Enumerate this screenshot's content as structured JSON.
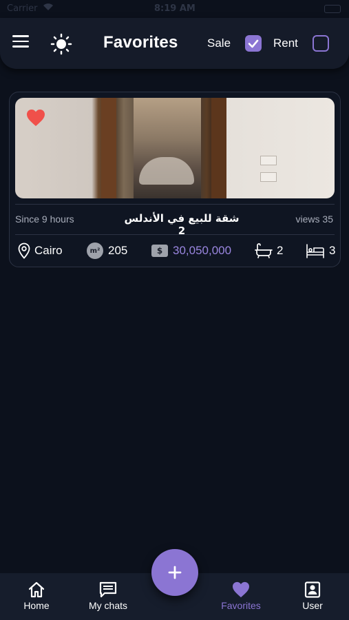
{
  "status_bar": {
    "carrier": "Carrier",
    "time": "8:19 AM"
  },
  "header": {
    "title": "Favorites",
    "filters": [
      {
        "label": "Sale",
        "checked": true
      },
      {
        "label": "Rent",
        "checked": false
      }
    ]
  },
  "listings": [
    {
      "favorited": true,
      "since": "Since 9 hours",
      "title": "شقة للبيع في الأندلس 2",
      "views": "views 35",
      "city": "Cairo",
      "area": "205",
      "area_unit": "m²",
      "price_symbol": "$",
      "price": "30,050,000",
      "bathrooms": "2",
      "bedrooms": "3"
    }
  ],
  "bottom_nav": {
    "items": [
      {
        "label": "Home",
        "icon": "home-icon"
      },
      {
        "label": "My chats",
        "icon": "chat-icon"
      },
      {
        "label": "Favorites",
        "icon": "heart-icon",
        "active": true
      },
      {
        "label": "User",
        "icon": "user-icon"
      }
    ],
    "fab_icon": "plus-icon"
  },
  "colors": {
    "background": "#0c111c",
    "accent": "#8b75d3",
    "heart": "#f0504a",
    "muted_text": "#a9aebb"
  }
}
